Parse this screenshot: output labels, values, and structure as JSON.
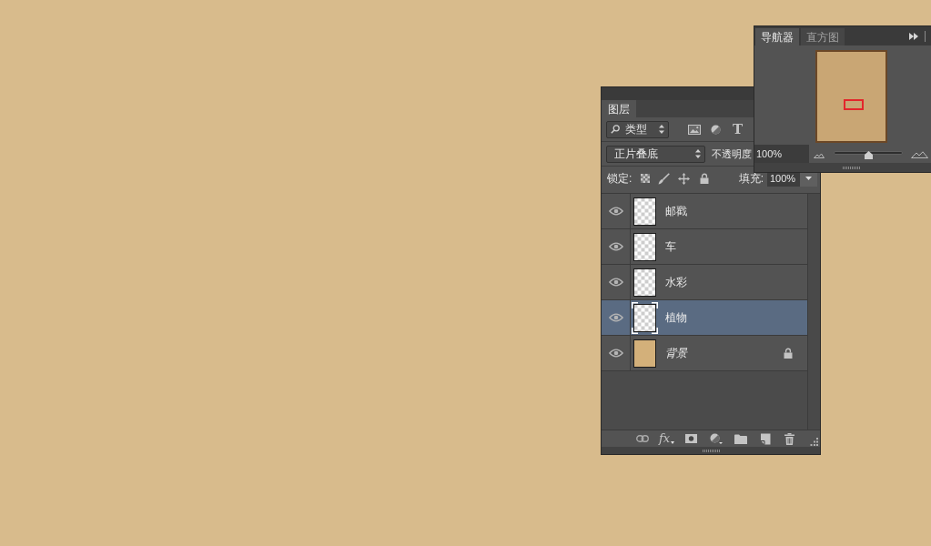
{
  "navigator_panel": {
    "tabs": [
      {
        "label": "导航器",
        "selected": true
      },
      {
        "label": "直方图",
        "selected": false
      }
    ],
    "zoom_field": {
      "value": "100%"
    },
    "zoom_slider": {
      "level": 0.5
    }
  },
  "layers_panel": {
    "tabs": [
      {
        "label": "图层",
        "selected": true
      }
    ],
    "filter": {
      "value": "类型"
    },
    "type_filter_label": "T",
    "blend_mode": {
      "value": "正片叠底"
    },
    "opacity_label": "不透明度",
    "lock_label": "锁定:",
    "fill_label": "填充:",
    "fill_field": {
      "value": "100%"
    },
    "layers": [
      {
        "name": "邮戳",
        "kind": "layer",
        "visible": true,
        "selected": false,
        "locked": false
      },
      {
        "name": "车",
        "kind": "layer",
        "visible": true,
        "selected": false,
        "locked": false
      },
      {
        "name": "水彩",
        "kind": "layer",
        "visible": true,
        "selected": false,
        "locked": false
      },
      {
        "name": "植物",
        "kind": "layer",
        "visible": true,
        "selected": true,
        "locked": false
      },
      {
        "name": "背景",
        "kind": "background",
        "visible": true,
        "selected": false,
        "locked": true
      }
    ],
    "style_button_label": "fx"
  }
}
